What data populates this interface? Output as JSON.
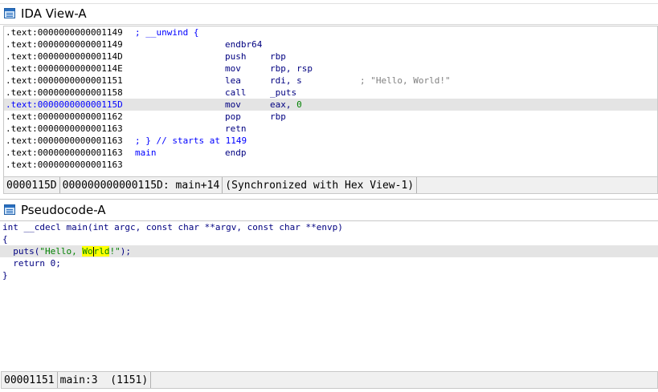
{
  "ida_view": {
    "title": "IDA View-A",
    "icon": "window-icon",
    "lines": [
      {
        "addr": ".text:0000000000001149",
        "comment": "; __unwind {"
      },
      {
        "addr": ".text:0000000000001149",
        "mnem": "endbr64",
        "op": ""
      },
      {
        "addr": ".text:000000000000114D",
        "mnem": "push",
        "op": "rbp"
      },
      {
        "addr": ".text:000000000000114E",
        "mnem": "mov",
        "op": "rbp, rsp"
      },
      {
        "addr": ".text:0000000000001151",
        "mnem": "lea",
        "op": "rdi, s",
        "str": "; \"Hello, World!\""
      },
      {
        "addr": ".text:0000000000001158",
        "mnem": "call",
        "op": "_puts"
      },
      {
        "addr": ".text:000000000000115D",
        "mnem": "mov",
        "op_prefix": "eax, ",
        "op_num": "0",
        "highlight": true
      },
      {
        "addr": ".text:0000000000001162",
        "mnem": "pop",
        "op": "rbp"
      },
      {
        "addr": ".text:0000000000001163",
        "mnem": "retn",
        "op": ""
      },
      {
        "addr": ".text:0000000000001163",
        "comment": "; } // starts at 1149"
      },
      {
        "addr": ".text:0000000000001163",
        "label": "main",
        "mnem": "endp",
        "op": ""
      },
      {
        "addr": ".text:0000000000001163"
      }
    ],
    "status": {
      "offset": "0000115D",
      "location": "000000000000115D: main+14",
      "sync": "(Synchronized with Hex View-1)"
    }
  },
  "pseudocode": {
    "title": "Pseudocode-A",
    "icon": "window-icon",
    "signature": "int __cdecl main(int argc, const char **argv, const char **envp)",
    "open_brace": "{",
    "puts_prefix": "  puts(",
    "puts_str_a": "\"Hello, ",
    "puts_str_b": "Wo",
    "puts_str_c": "rld",
    "puts_str_d": "!\"",
    "puts_suffix": ");",
    "return_line": "  return 0;",
    "close_brace": "}",
    "status": {
      "offset": "00001151",
      "location": "main:3  (1151)"
    }
  }
}
